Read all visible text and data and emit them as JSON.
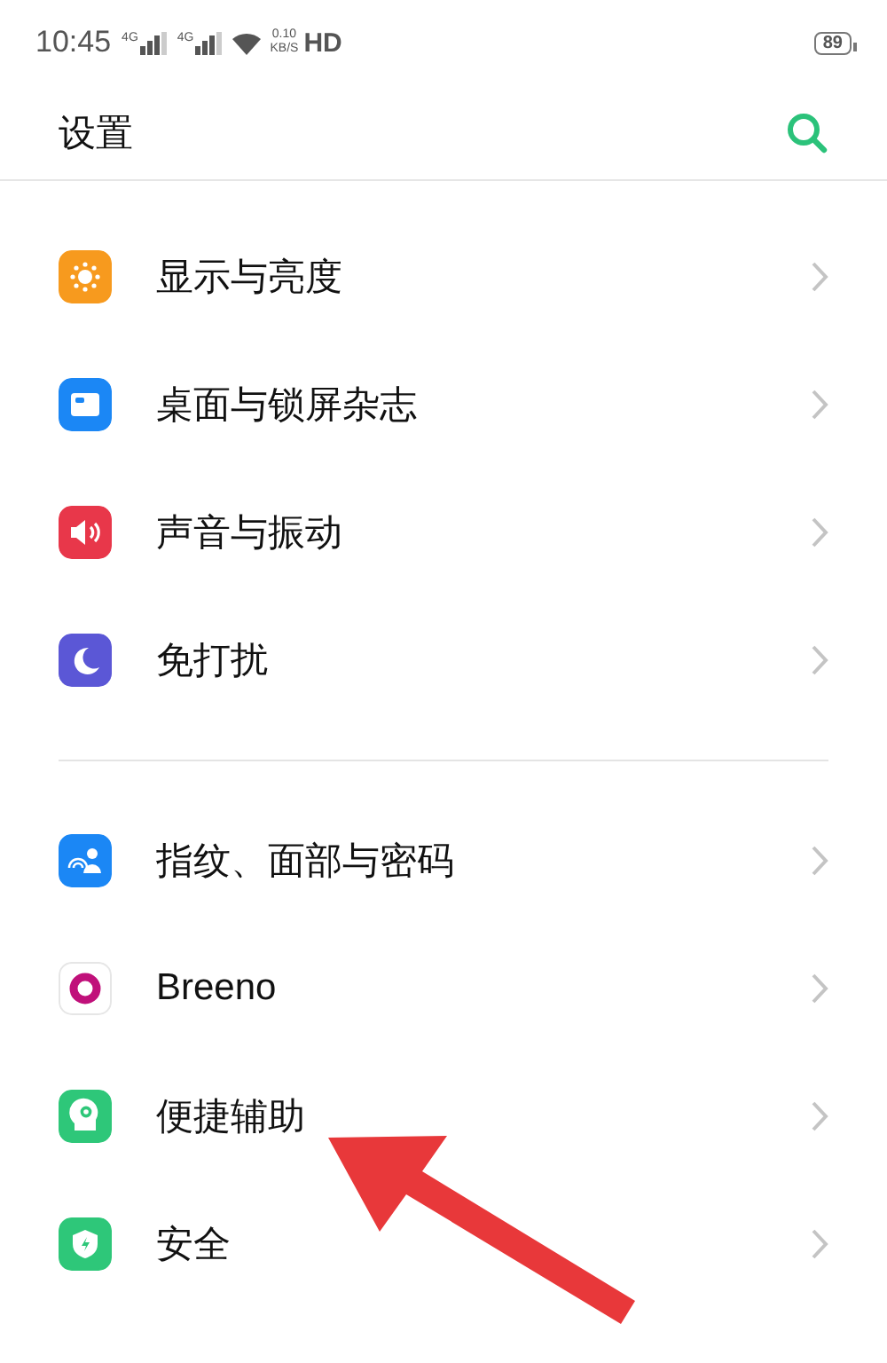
{
  "status_bar": {
    "time": "10:45",
    "network_1": "4G",
    "network_2": "4G",
    "speed_value": "0.10",
    "speed_unit": "KB/S",
    "hd": "HD",
    "battery": "89"
  },
  "header": {
    "title": "设置"
  },
  "groups": [
    {
      "items": [
        {
          "kind": "brightness",
          "color": "#f79a1e",
          "label": "显示与亮度"
        },
        {
          "kind": "wallpaper",
          "color": "#1b87f5",
          "label": "桌面与锁屏杂志"
        },
        {
          "kind": "sound",
          "color": "#e8374a",
          "label": "声音与振动"
        },
        {
          "kind": "moon",
          "color": "#5b57d6",
          "label": "免打扰"
        }
      ]
    },
    {
      "items": [
        {
          "kind": "fingerprint",
          "color": "#1b87f5",
          "label": "指纹、面部与密码"
        },
        {
          "kind": "ring",
          "color": "#c0107a",
          "label": "Breeno"
        },
        {
          "kind": "head",
          "color": "#2ec779",
          "label": "便捷辅助"
        },
        {
          "kind": "shield",
          "color": "#2ec779",
          "label": "安全"
        }
      ]
    }
  ]
}
